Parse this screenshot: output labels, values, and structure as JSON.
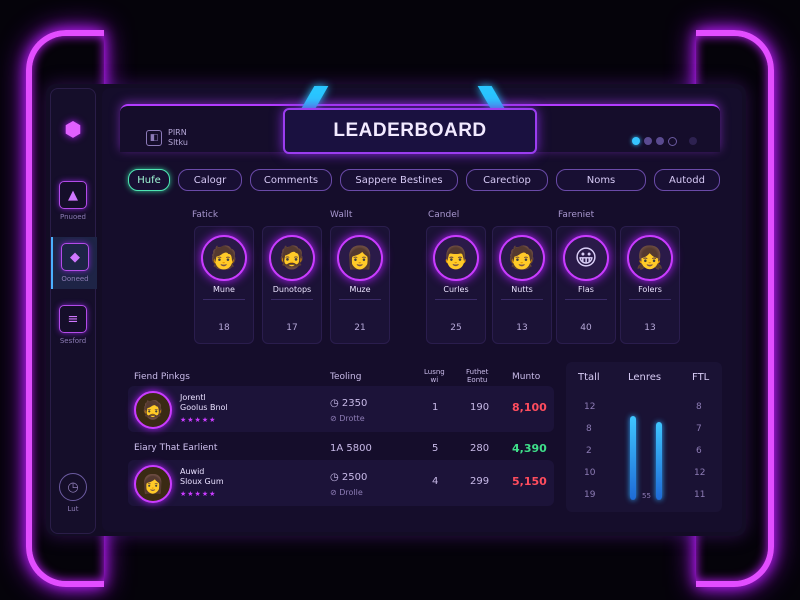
{
  "header": {
    "title": "LEADERBOARD",
    "brand_line1": "PIRN",
    "brand_line2": "Sltku"
  },
  "sidebar": [
    {
      "label": "",
      "icon": "shield-logo-icon"
    },
    {
      "label": "Pnuoed",
      "icon": "trophy-icon"
    },
    {
      "label": "Ooneed",
      "icon": "cube-icon"
    },
    {
      "label": "Sesford",
      "icon": "list-icon"
    },
    {
      "label": "Lut",
      "icon": "clock-icon"
    }
  ],
  "tabs": [
    "Hufe",
    "Calogr",
    "Comments",
    "Sappere Bestines",
    "Carectiop",
    "Noms",
    "Autodd"
  ],
  "groups": [
    "Fatick",
    "Wallt",
    "Candel",
    "Fareniet"
  ],
  "players": [
    {
      "name": "Mune",
      "score": "18",
      "face": "🧑"
    },
    {
      "name": "Dunotops",
      "score": "17",
      "face": "🧔"
    },
    {
      "name": "Muze",
      "score": "21",
      "face": "👩"
    },
    {
      "name": "Curles",
      "score": "25",
      "face": "👨"
    },
    {
      "name": "Nutts",
      "score": "13",
      "face": "🧑"
    },
    {
      "name": "Flas",
      "score": "40",
      "face": "😀"
    },
    {
      "name": "Folers",
      "score": "13",
      "face": "👧"
    }
  ],
  "table": {
    "section1": "Fiend Pinkgs",
    "section2": "Eiary That Earlient",
    "headers": {
      "rating": "Teoling",
      "col3a": "Lusng",
      "col3b": "wi",
      "col4a": "Futhet",
      "col4b": "Eontu",
      "col5": "Munto"
    },
    "rows": [
      {
        "name1": "Jorentl",
        "name2": "Goolus Bnol",
        "time": "2350",
        "sub": "Drotte",
        "c3": "1",
        "c4": "190",
        "c5": "8,100",
        "c5_color": "red",
        "face": "🧔"
      },
      {
        "name1": "Auwid",
        "name2": "Sloux Gum",
        "time": "2500",
        "sub": "Drolle",
        "c3": "4",
        "c4": "299",
        "c5": "5,150",
        "c5_color": "red",
        "face": "👩"
      }
    ],
    "mid_row": {
      "time": "1A 5800",
      "c3": "5",
      "c4": "280",
      "c5": "4,390"
    }
  },
  "stats": {
    "cols": [
      "Ttall",
      "Lenres",
      "FTL"
    ],
    "left_nums": [
      "12",
      "8",
      "2",
      "10",
      "19"
    ],
    "right_nums": [
      "8",
      "7",
      "6",
      "12",
      "11"
    ],
    "bar_label": "55"
  }
}
